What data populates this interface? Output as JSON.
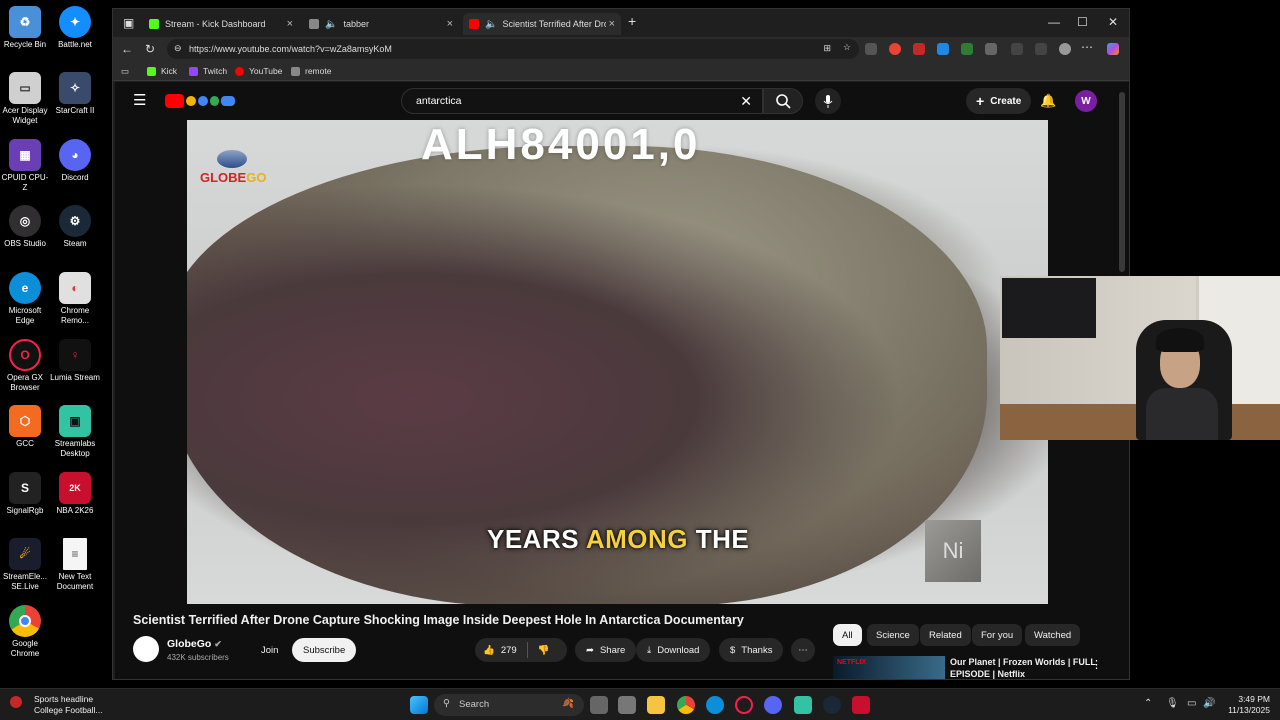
{
  "desktop": {
    "icons": [
      {
        "label": "Recycle Bin",
        "color": "#4a90d9"
      },
      {
        "label": "Battle.net",
        "color": "#148eff"
      },
      {
        "label": "Acer Display Widget",
        "color": "#d0d0d0"
      },
      {
        "label": "StarCraft II",
        "color": "#3a4a6a"
      },
      {
        "label": "CPUID CPU-Z",
        "color": "#6a3fb5"
      },
      {
        "label": "Discord",
        "color": "#5865f2"
      },
      {
        "label": "OBS Studio",
        "color": "#302e31"
      },
      {
        "label": "Steam",
        "color": "#1b2838"
      },
      {
        "label": "Microsoft Edge",
        "color": "#0c8ed9"
      },
      {
        "label": "Chrome Remo...",
        "color": "#e0e0e0"
      },
      {
        "label": "Opera GX Browser",
        "color": "#fa1e4e"
      },
      {
        "label": "Lumia Stream",
        "color": "#d9264e"
      },
      {
        "label": "GCC",
        "color": "#f36b21"
      },
      {
        "label": "Streamlabs Desktop",
        "color": "#31c3a2"
      },
      {
        "label": "SignalRgb",
        "color": "#222"
      },
      {
        "label": "NBA 2K26",
        "color": "#c8102e"
      },
      {
        "label": "StreamEle... SE.Live",
        "color": "#1a1d2e"
      },
      {
        "label": "New Text Document",
        "color": "#f5f5f5"
      },
      {
        "label": "Google Chrome",
        "color": "#4285f4"
      }
    ]
  },
  "browser": {
    "tabs": [
      {
        "label": "Stream - Kick Dashboard",
        "color": "#53fc18"
      },
      {
        "label": "tabber",
        "color": "#888"
      },
      {
        "label": "Scientist Terrified After Dron",
        "color": "#ff0000"
      }
    ],
    "url": "https://www.youtube.com/watch?v=wZa8amsyKoM",
    "bookmarks": [
      {
        "label": "Kick",
        "color": "#53fc18"
      },
      {
        "label": "Twitch",
        "color": "#9146ff"
      },
      {
        "label": "YouTube",
        "color": "#ff0000"
      },
      {
        "label": "remote",
        "color": "#888"
      }
    ]
  },
  "youtube": {
    "search_value": "antarctica",
    "create_label": "Create",
    "avatar_letter": "W",
    "player": {
      "overlay_text": "ALH84001,0",
      "logo_a": "GLOBE",
      "logo_b": "GO",
      "subtitle_a": "YEARS",
      "subtitle_b": "AMONG",
      "subtitle_c": "THE",
      "cube_label": "Ni"
    },
    "video_title": "Scientist Terrified After Drone Capture Shocking Image Inside Deepest Hole In Antarctica Documentary",
    "channel": {
      "name": "GlobeGo",
      "subscribers": "432K subscribers"
    },
    "join_label": "Join",
    "subscribe_label": "Subscribe",
    "likes": "279",
    "share_label": "Share",
    "download_label": "Download",
    "thanks_label": "Thanks",
    "chips": [
      "All",
      "Science",
      "Related",
      "For you",
      "Watched"
    ],
    "recommended": {
      "thumb_label": "NETFLIX",
      "title": "Our Planet | Frozen Worlds | FULL EPISODE | Netflix"
    }
  },
  "taskbar": {
    "news_title": "Sports headline",
    "news_sub": "College Football...",
    "search_label": "Search",
    "time": "3:49 PM",
    "date": "11/13/2025"
  }
}
